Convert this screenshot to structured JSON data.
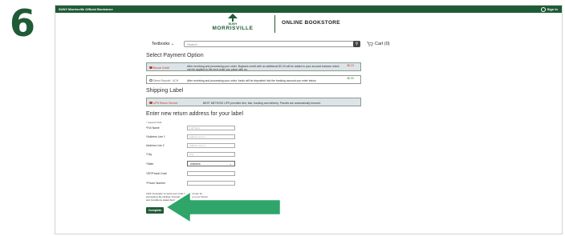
{
  "step_number": "6",
  "topbar": {
    "title": "SUNY Morrisville Official Bookstore",
    "signin": "Sign In"
  },
  "brand": {
    "suny": "SUNY",
    "morrisville": "MORRISVILLE",
    "store": "ONLINE BOOKSTORE"
  },
  "nav": {
    "textbooks": "Textbooks ⌄",
    "search_placeholder": "Search",
    "cart": "Cart (0)"
  },
  "payment": {
    "heading": "Select Payment Option",
    "options": [
      {
        "name": "Bursar Credit",
        "desc": "After receiving and processing your order, Buyback credit with an additional $0.23 will be added to your account balance which can be applied to the next order you place with us.",
        "price": "$0.23",
        "selected": true
      },
      {
        "name": "Direct Deposit - ACH",
        "desc": "After receiving and processing your order, funds will be deposited into the banking account you enter below.",
        "price": "$0.00",
        "selected": false
      }
    ]
  },
  "shipping": {
    "heading": "Shipping Label",
    "option": {
      "name": "UPS Return Service",
      "desc": "BEST METHOD! UPS provides free, fast, tracking and delivery. Parcels are automatically insured."
    }
  },
  "address": {
    "heading": "Enter new return address for your label",
    "required_note": "* required field",
    "fields": [
      {
        "label": "*Full Name",
        "placeholder": "Full Name"
      },
      {
        "label": "*Address Line 1",
        "placeholder": "Address Line 1"
      },
      {
        "label": "Address Line 2",
        "placeholder": "Address Line 2"
      },
      {
        "label": "*City",
        "placeholder": "City"
      },
      {
        "label": "*State",
        "value": "Alabama"
      },
      {
        "label": "*ZIP/Postal Code",
        "placeholder": ""
      },
      {
        "label": "*Phone Number",
        "placeholder": ""
      }
    ],
    "terms": "Click 'Complete' to send your order to efollett.com for processing. By clicking 'Complete' you agree to our Terms and Conditions stated below.",
    "complete_label": "Complete"
  },
  "colors": {
    "brand_green": "#1f5b36",
    "arrow_green": "#2fa56a",
    "accent_red": "#c0392b"
  }
}
